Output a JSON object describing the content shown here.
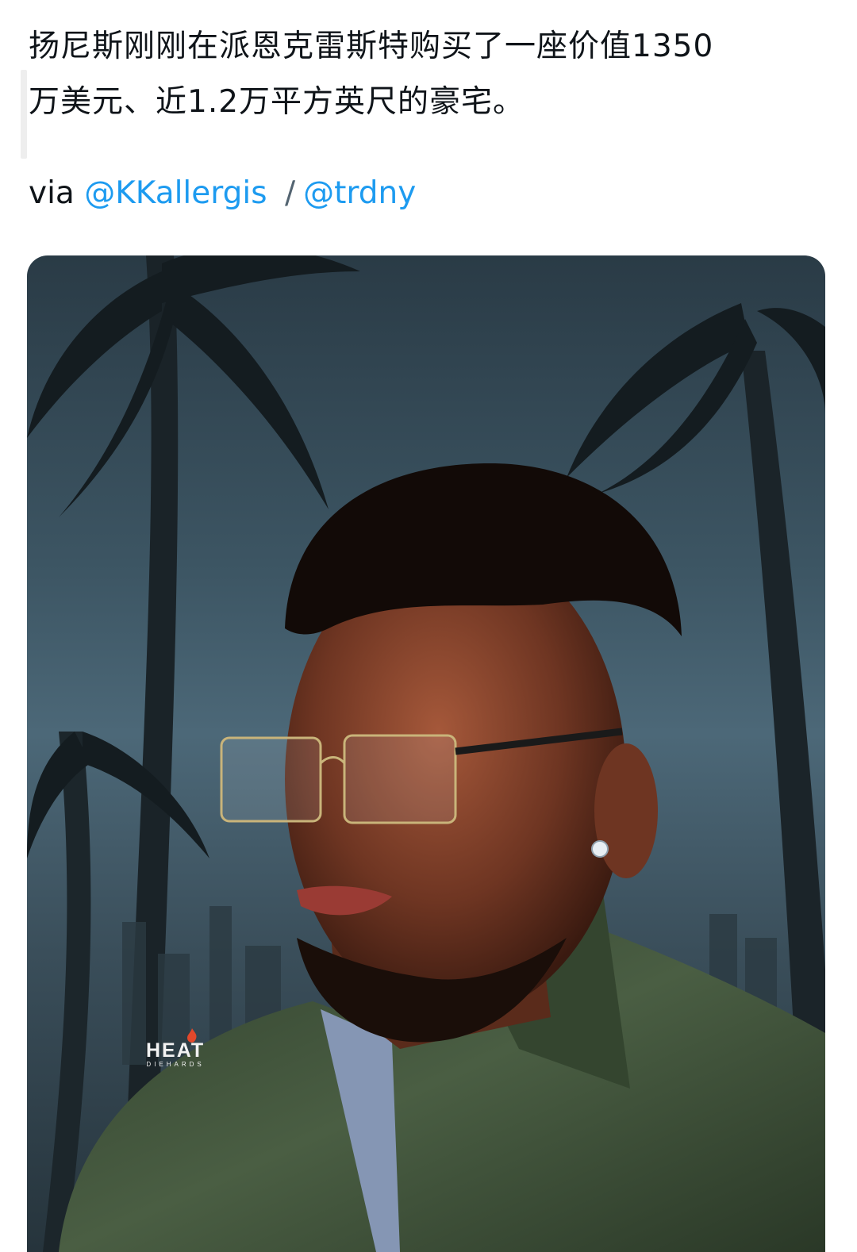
{
  "tweet": {
    "text_line1": "扬尼斯刚刚在派恩克雷斯特购买了一座价值1350",
    "text_line2": "万美元、近1.2万平方英尺的豪宅。",
    "via_label": "via",
    "mention_1": "@KKallergis",
    "separator": "/",
    "mention_2": "@trdny"
  },
  "media": {
    "watermark_main": "HEAT",
    "watermark_sub": "DIEHARDS"
  },
  "colors": {
    "mention": "#1d9bf0",
    "text": "#0f1419",
    "shirt": "#3e5138"
  }
}
